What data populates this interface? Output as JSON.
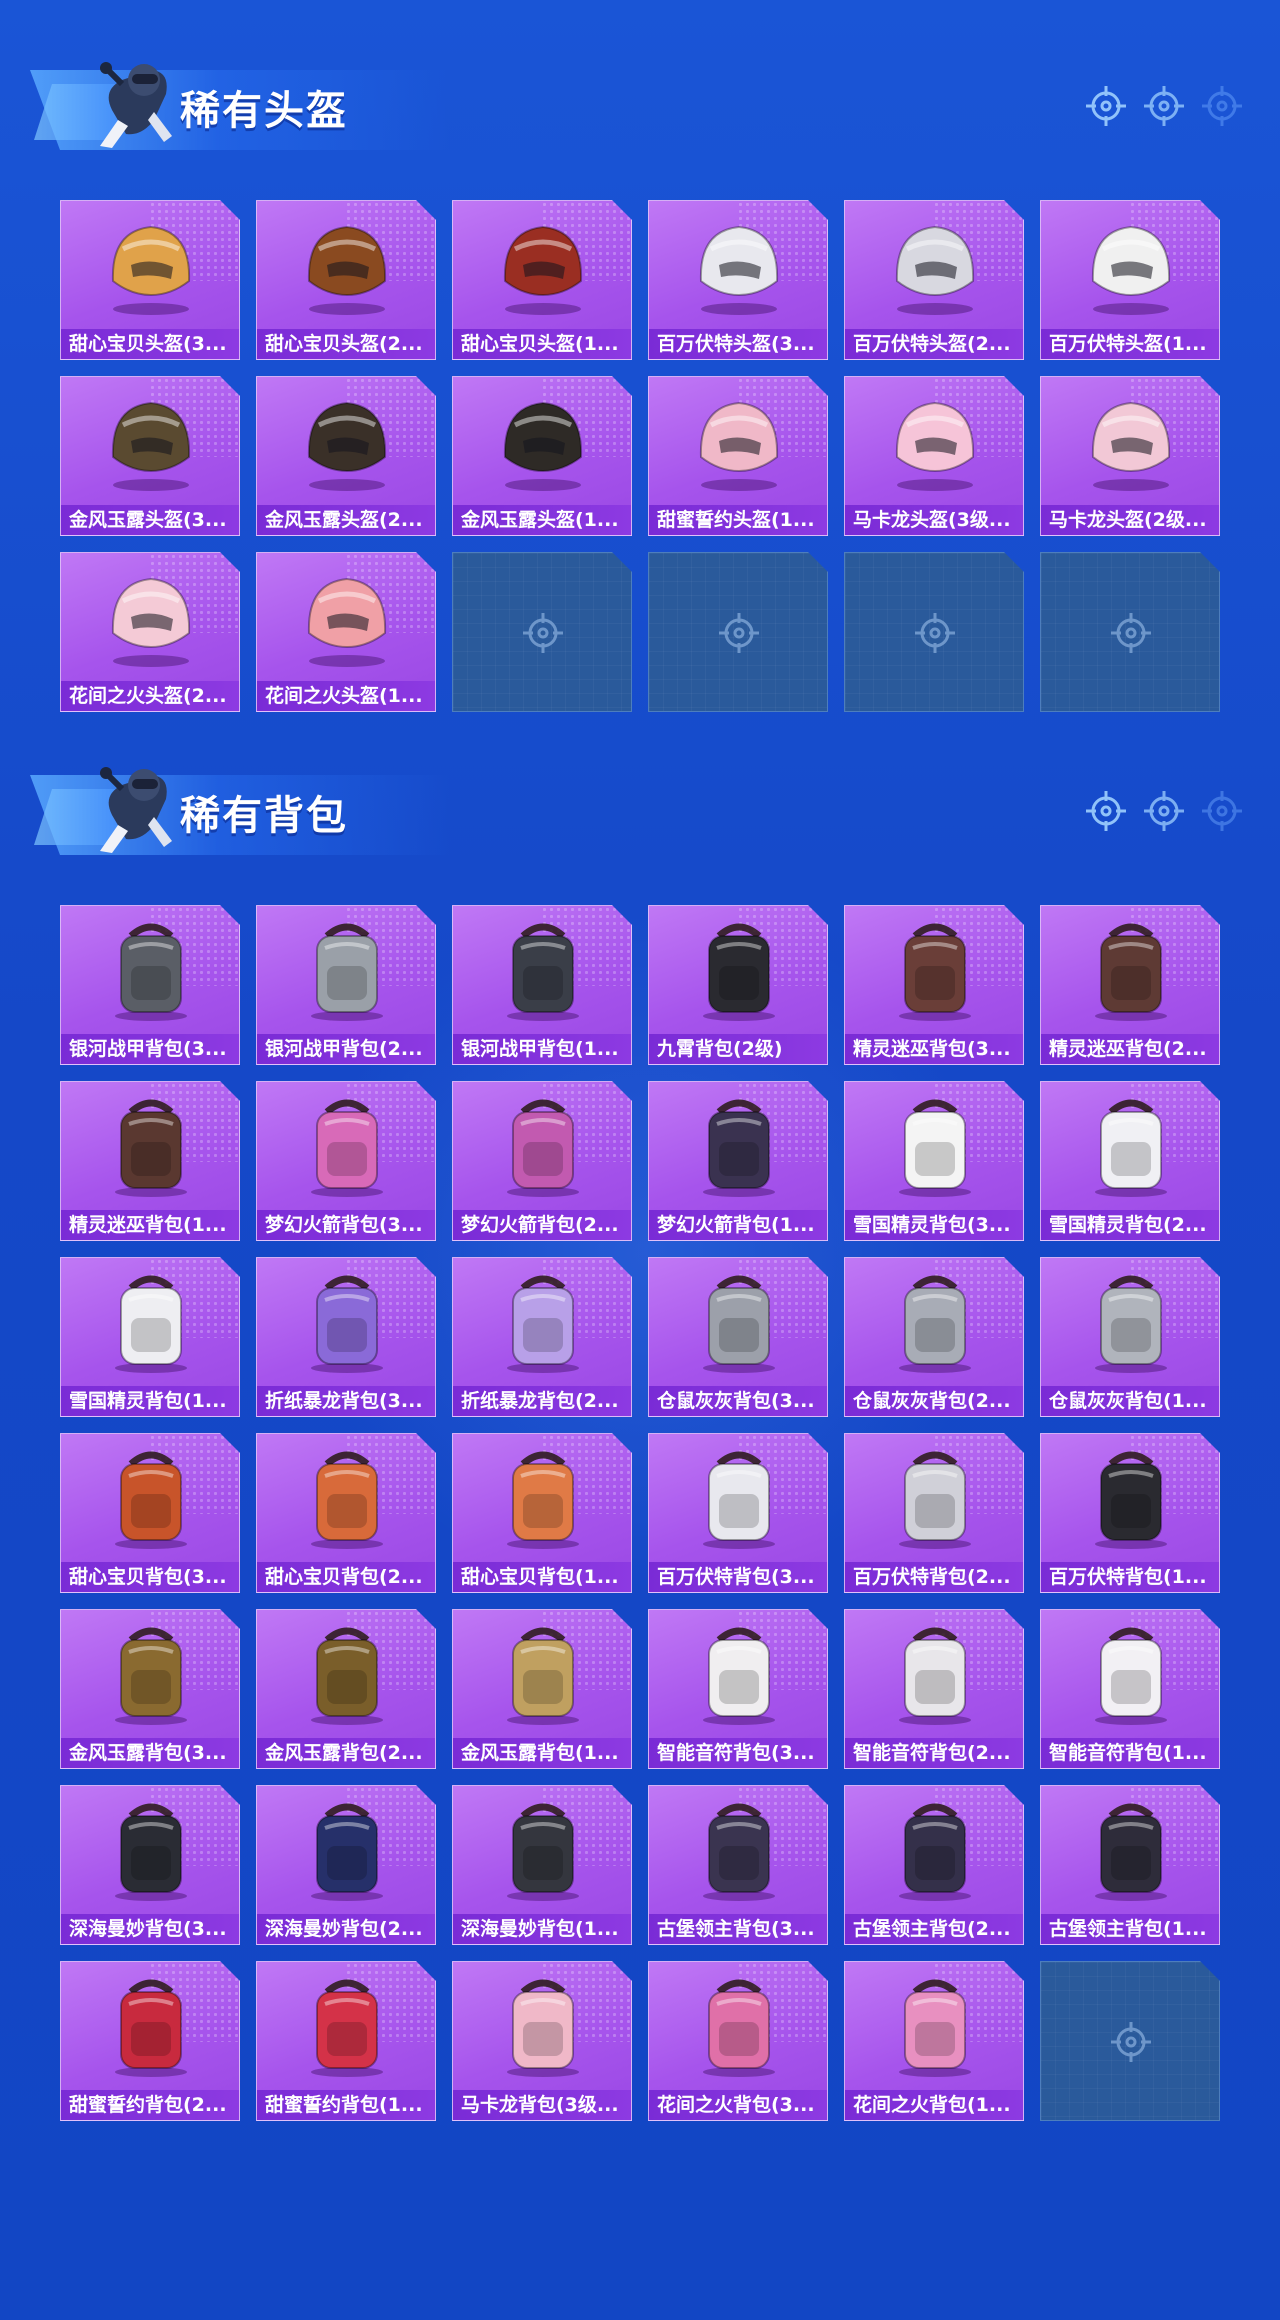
{
  "sections": [
    {
      "title": "稀有头盔",
      "items": [
        {
          "label": "甜心宝贝头盔(3...",
          "kind": "helmet",
          "color": "#e0a24a"
        },
        {
          "label": "甜心宝贝头盔(2...",
          "kind": "helmet",
          "color": "#8a4a20"
        },
        {
          "label": "甜心宝贝头盔(1...",
          "kind": "helmet",
          "color": "#9a2e22"
        },
        {
          "label": "百万伏特头盔(3...",
          "kind": "helmet",
          "color": "#e8e8ee"
        },
        {
          "label": "百万伏特头盔(2...",
          "kind": "helmet",
          "color": "#d8d8e0"
        },
        {
          "label": "百万伏特头盔(1...",
          "kind": "helmet",
          "color": "#f0f0f0"
        },
        {
          "label": "金风玉露头盔(3...",
          "kind": "helmet",
          "color": "#5a4a30"
        },
        {
          "label": "金风玉露头盔(2...",
          "kind": "helmet",
          "color": "#3a3028"
        },
        {
          "label": "金风玉露头盔(1...",
          "kind": "helmet",
          "color": "#2e2a26"
        },
        {
          "label": "甜蜜誓约头盔(1...",
          "kind": "helmet",
          "color": "#f0b8c8"
        },
        {
          "label": "马卡龙头盔(3级...",
          "kind": "helmet",
          "color": "#f6c4d8"
        },
        {
          "label": "马卡龙头盔(2级...",
          "kind": "helmet",
          "color": "#f2c8d6"
        },
        {
          "label": "花间之火头盔(2...",
          "kind": "helmet",
          "color": "#f4cad6"
        },
        {
          "label": "花间之火头盔(1...",
          "kind": "helmet",
          "color": "#f0a0a6"
        }
      ],
      "empty_slots": 4
    },
    {
      "title": "稀有背包",
      "items": [
        {
          "label": "银河战甲背包(3...",
          "kind": "backpack",
          "color": "#5a5e66"
        },
        {
          "label": "银河战甲背包(2...",
          "kind": "backpack",
          "color": "#9aa0a8"
        },
        {
          "label": "银河战甲背包(1...",
          "kind": "backpack",
          "color": "#3a3e48"
        },
        {
          "label": "九霄背包(2级)",
          "kind": "backpack",
          "color": "#2a2a30"
        },
        {
          "label": "精灵迷巫背包(3...",
          "kind": "backpack",
          "color": "#6a3e38"
        },
        {
          "label": "精灵迷巫背包(2...",
          "kind": "backpack",
          "color": "#5e3a34"
        },
        {
          "label": "精灵迷巫背包(1...",
          "kind": "backpack",
          "color": "#5a3830"
        },
        {
          "label": "梦幻火箭背包(3...",
          "kind": "backpack",
          "color": "#d86ab8"
        },
        {
          "label": "梦幻火箭背包(2...",
          "kind": "backpack",
          "color": "#c25ab0"
        },
        {
          "label": "梦幻火箭背包(1...",
          "kind": "backpack",
          "color": "#3a3250"
        },
        {
          "label": "雪国精灵背包(3...",
          "kind": "backpack",
          "color": "#f4f4f4"
        },
        {
          "label": "雪国精灵背包(2...",
          "kind": "backpack",
          "color": "#f0f0f4"
        },
        {
          "label": "雪国精灵背包(1...",
          "kind": "backpack",
          "color": "#eeeef2"
        },
        {
          "label": "折纸暴龙背包(3...",
          "kind": "backpack",
          "color": "#8a6ad8"
        },
        {
          "label": "折纸暴龙背包(2...",
          "kind": "backpack",
          "color": "#b8a0e8"
        },
        {
          "label": "仓鼠灰灰背包(3...",
          "kind": "backpack",
          "color": "#9ca0aa"
        },
        {
          "label": "仓鼠灰灰背包(2...",
          "kind": "backpack",
          "color": "#a8acb6"
        },
        {
          "label": "仓鼠灰灰背包(1...",
          "kind": "backpack",
          "color": "#b0b4bc"
        },
        {
          "label": "甜心宝贝背包(3...",
          "kind": "backpack",
          "color": "#c8542a"
        },
        {
          "label": "甜心宝贝背包(2...",
          "kind": "backpack",
          "color": "#d86a3a"
        },
        {
          "label": "甜心宝贝背包(1...",
          "kind": "backpack",
          "color": "#e07a46"
        },
        {
          "label": "百万伏特背包(3...",
          "kind": "backpack",
          "color": "#e8e8ee"
        },
        {
          "label": "百万伏特背包(2...",
          "kind": "backpack",
          "color": "#d0d0d8"
        },
        {
          "label": "百万伏特背包(1...",
          "kind": "backpack",
          "color": "#2a2a30"
        },
        {
          "label": "金风玉露背包(3...",
          "kind": "backpack",
          "color": "#8a6a30"
        },
        {
          "label": "金风玉露背包(2...",
          "kind": "backpack",
          "color": "#7a5e2a"
        },
        {
          "label": "金风玉露背包(1...",
          "kind": "backpack",
          "color": "#c0a060"
        },
        {
          "label": "智能音符背包(3...",
          "kind": "backpack",
          "color": "#f0eef0"
        },
        {
          "label": "智能音符背包(2...",
          "kind": "backpack",
          "color": "#e8e6ea"
        },
        {
          "label": "智能音符背包(1...",
          "kind": "backpack",
          "color": "#f2f0f4"
        },
        {
          "label": "深海曼妙背包(3...",
          "kind": "backpack",
          "color": "#2a2c34"
        },
        {
          "label": "深海曼妙背包(2...",
          "kind": "backpack",
          "color": "#26306a"
        },
        {
          "label": "深海曼妙背包(1...",
          "kind": "backpack",
          "color": "#34363e"
        },
        {
          "label": "古堡领主背包(3...",
          "kind": "backpack",
          "color": "#3a3450"
        },
        {
          "label": "古堡领主背包(2...",
          "kind": "backpack",
          "color": "#34304a"
        },
        {
          "label": "古堡领主背包(1...",
          "kind": "backpack",
          "color": "#2e2c3a"
        },
        {
          "label": "甜蜜誓约背包(2...",
          "kind": "backpack",
          "color": "#c82a3e"
        },
        {
          "label": "甜蜜誓约背包(1...",
          "kind": "backpack",
          "color": "#d43248"
        },
        {
          "label": "马卡龙背包(3级...",
          "kind": "backpack",
          "color": "#f0b8c8"
        },
        {
          "label": "花间之火背包(3...",
          "kind": "backpack",
          "color": "#e070a8"
        },
        {
          "label": "花间之火背包(1...",
          "kind": "backpack",
          "color": "#e890c0"
        }
      ],
      "empty_slots": 1
    }
  ],
  "icons": {
    "mascot": "skydiver-mascot-icon",
    "target": "crosshair-target-icon",
    "empty": "empty-slot-crosshair-icon"
  }
}
